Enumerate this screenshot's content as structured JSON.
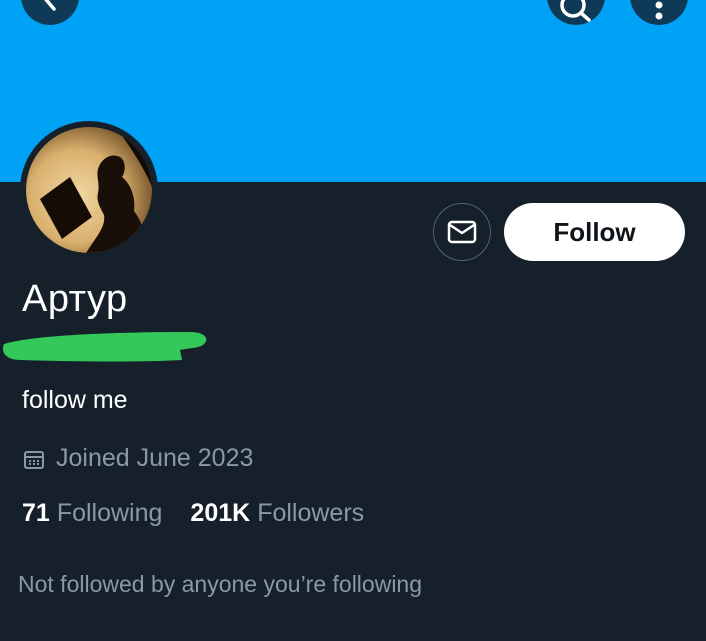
{
  "profile": {
    "display_name": "Артур",
    "bio": "follow me",
    "joined": "Joined June 2023",
    "following_count": "71",
    "following_label": "Following",
    "followers_count": "201K",
    "followers_label": "Followers",
    "not_followed_text": "Not followed by anyone you’re following"
  },
  "actions": {
    "follow_label": "Follow"
  },
  "colors": {
    "banner": "#00a2f5",
    "background": "#15202b",
    "secondary_text": "#8b98a5",
    "redaction_mark": "#34c759"
  },
  "icons": [
    "back-arrow-icon",
    "search-icon",
    "more-icon",
    "mail-icon",
    "calendar-icon"
  ]
}
